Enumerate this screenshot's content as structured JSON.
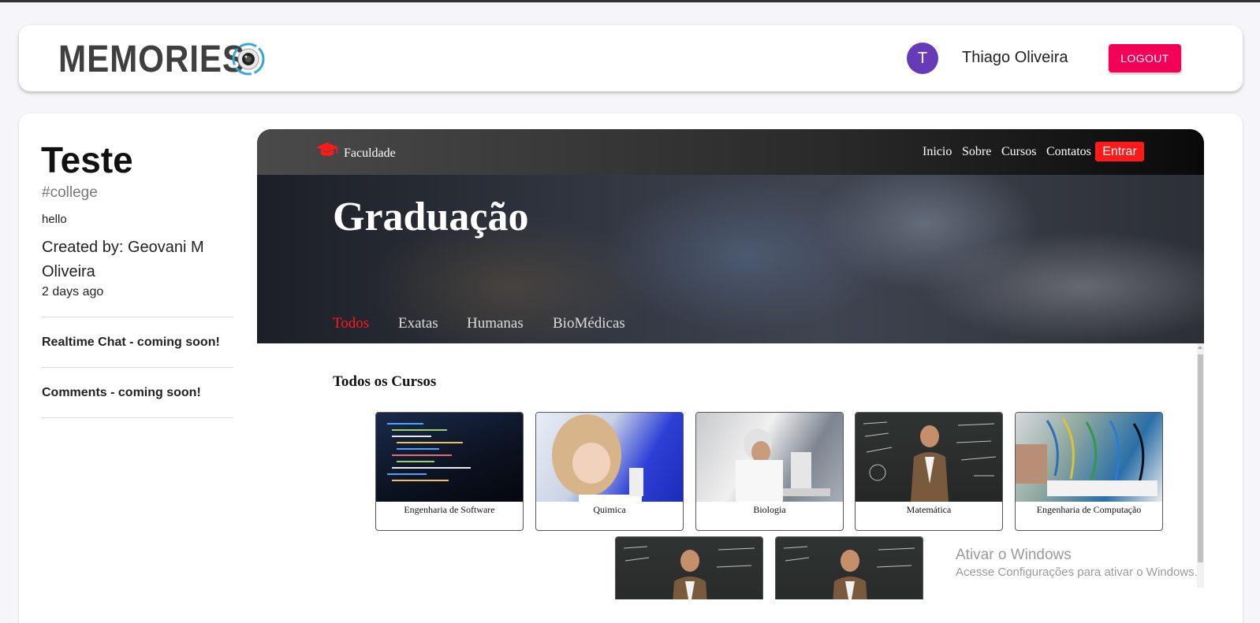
{
  "appbar": {
    "logo_text": "MEMORIES",
    "avatar_initial": "T",
    "user_name": "Thiago Oliveira",
    "logout_label": "LOGOUT"
  },
  "post": {
    "title": "Teste",
    "tags": "#college",
    "message": "hello",
    "created_by": "Created by: Geovani M Oliveira",
    "time": "2 days ago",
    "realtime_chat": "Realtime Chat - coming soon!",
    "comments": "Comments - coming soon!"
  },
  "site": {
    "brand": "Faculdade",
    "nav": [
      "Inicio",
      "Sobre",
      "Cursos",
      "Contatos"
    ],
    "enter_label": "Entrar",
    "hero_title": "Graduação",
    "categories": [
      "Todos",
      "Exatas",
      "Humanas",
      "BioMédicas"
    ],
    "active_category": "Todos",
    "section_title": "Todos os Cursos",
    "courses": [
      "Engenharia de Software",
      "Quimica",
      "Biologia",
      "Matemática",
      "Engenharia de Computação"
    ]
  },
  "watermark": {
    "line1": "Ativar o Windows",
    "line2": "Acesse Configurações para ativar o Windows."
  },
  "colors": {
    "logout": "#f50057",
    "avatar": "#673ab7",
    "accent_red": "#ff1a1a"
  }
}
